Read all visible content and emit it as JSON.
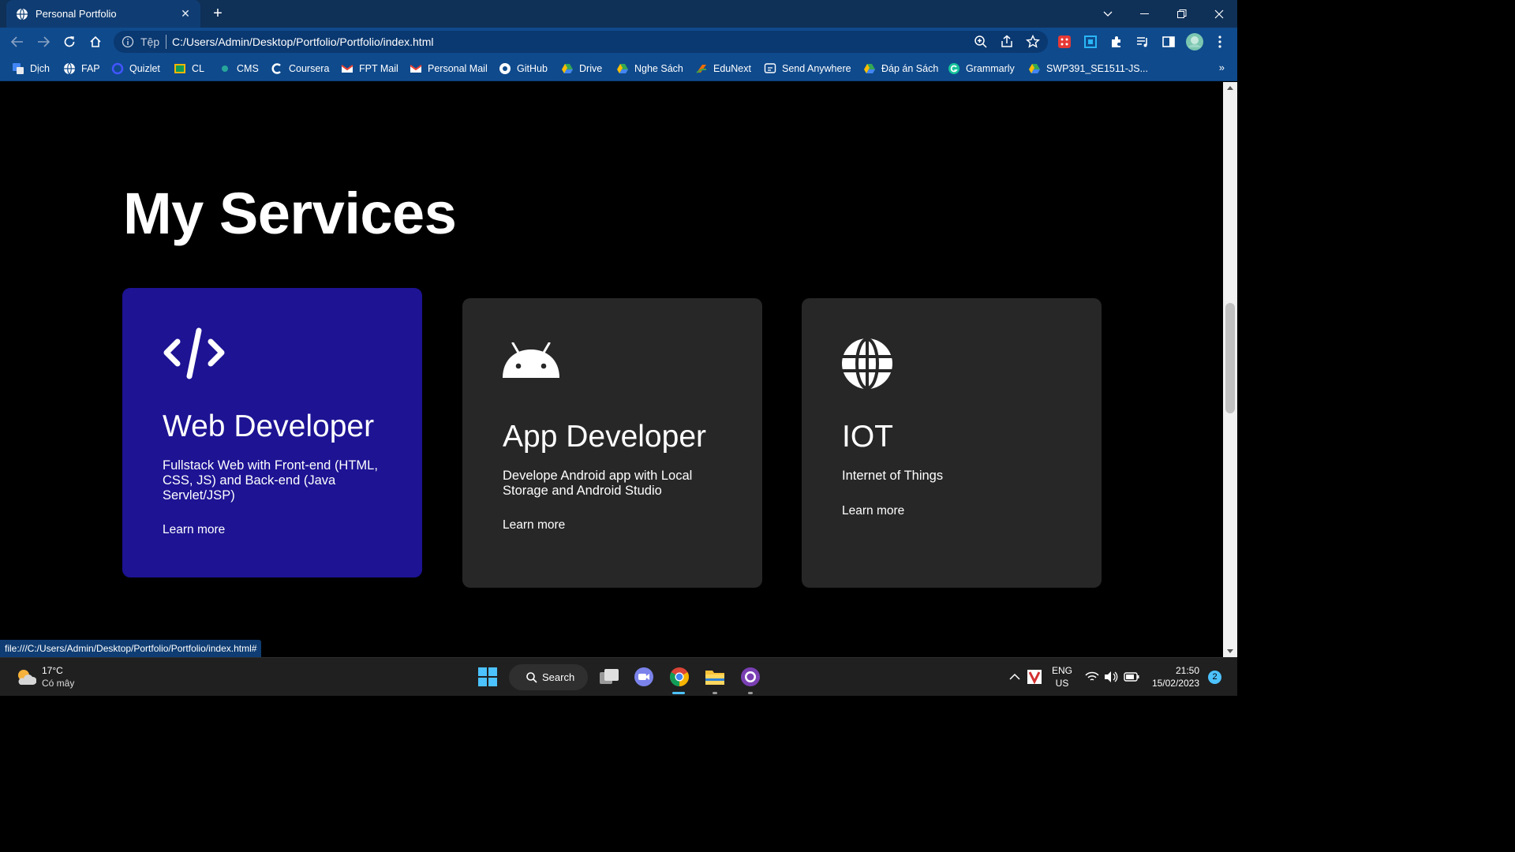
{
  "browser": {
    "tab_title": "Personal Portfolio",
    "omnibox_prefix": "Tệp",
    "url": "C:/Users/Admin/Desktop/Portfolio/Portfolio/index.html",
    "status_url": "file:///C:/Users/Admin/Desktop/Portfolio/Portfolio/index.html#",
    "bookmarks": [
      {
        "label": "Dịch",
        "icon": "translate-icon"
      },
      {
        "label": "FAP",
        "icon": "globe-icon"
      },
      {
        "label": "Quizlet",
        "icon": "quizlet-icon"
      },
      {
        "label": "CL",
        "icon": "classroom-icon"
      },
      {
        "label": "CMS",
        "icon": "cms-icon"
      },
      {
        "label": "Coursera",
        "icon": "coursera-icon"
      },
      {
        "label": "FPT Mail",
        "icon": "gmail-icon"
      },
      {
        "label": "Personal Mail",
        "icon": "gmail-icon"
      },
      {
        "label": "GitHub",
        "icon": "github-icon"
      },
      {
        "label": "Drive",
        "icon": "drive-icon"
      },
      {
        "label": "Nghe Sách",
        "icon": "drive-icon"
      },
      {
        "label": "EduNext",
        "icon": "edunext-icon"
      },
      {
        "label": "Send Anywhere",
        "icon": "send-anywhere-icon"
      },
      {
        "label": "Đáp án Sách",
        "icon": "drive-icon"
      },
      {
        "label": "Grammarly",
        "icon": "grammarly-icon"
      },
      {
        "label": "SWP391_SE1511-JS...",
        "icon": "drive-icon"
      }
    ],
    "bookmarks_overflow": "»"
  },
  "page": {
    "heading": "My Services",
    "services": [
      {
        "title": "Web Developer",
        "description": "Fullstack Web with Front-end (HTML, CSS, JS) and Back-end (Java Servlet/JSP)",
        "link": "Learn more",
        "icon": "code-icon",
        "highlighted": true
      },
      {
        "title": "App Developer",
        "description": "Develope Android app with Local Storage and Android Studio",
        "link": "Learn more",
        "icon": "android-icon",
        "highlighted": false
      },
      {
        "title": "IOT",
        "description": "Internet of Things",
        "link": "Learn more",
        "icon": "globe-icon",
        "highlighted": false
      }
    ],
    "colors": {
      "background": "#000000",
      "card": "#272727",
      "card_highlight": "#1d1393",
      "text": "#ffffff"
    }
  },
  "taskbar": {
    "weather_temp": "17°C",
    "weather_desc": "Có mây",
    "search_label": "Search",
    "lang_top": "ENG",
    "lang_bottom": "US",
    "time": "21:50",
    "date": "15/02/2023",
    "notification_count": "2"
  }
}
